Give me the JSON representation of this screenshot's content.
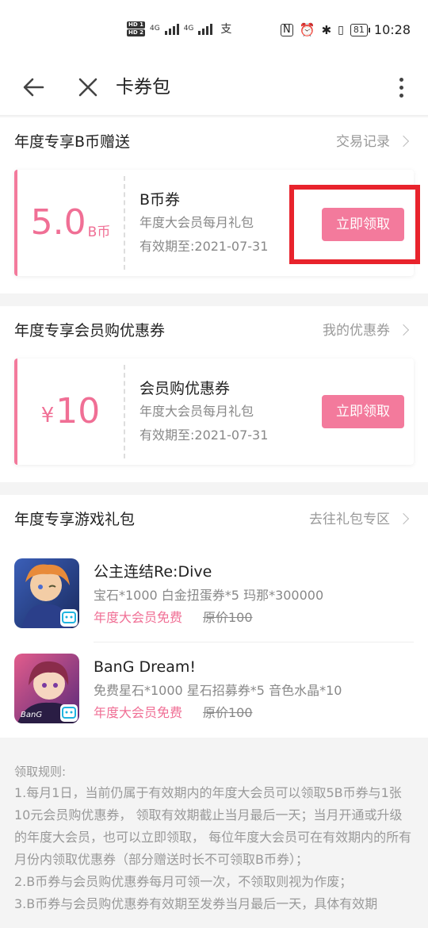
{
  "status_bar": {
    "hd1": "HD 1",
    "hd2": "HD 2",
    "net1": "4G",
    "net2": "4G",
    "pay_icon": "支",
    "battery": "81",
    "time": "10:28"
  },
  "toolbar": {
    "title": "卡券包"
  },
  "bcoin_section": {
    "title": "年度专享B币赠送",
    "link": "交易记录",
    "coupon": {
      "amount": "5.0",
      "unit": "B币",
      "name": "B币券",
      "desc": "年度大会员每月礼包",
      "expiry": "有效期至:2021-07-31",
      "button": "立即领取"
    }
  },
  "member_section": {
    "title": "年度专享会员购优惠券",
    "link": "我的优惠券",
    "coupon": {
      "currency": "¥",
      "amount": "10",
      "name": "会员购优惠券",
      "desc": "年度大会员每月礼包",
      "expiry": "有效期至:2021-07-31",
      "button": "立即领取"
    }
  },
  "game_section": {
    "title": "年度专享游戏礼包",
    "link": "去往礼包专区",
    "games": [
      {
        "name": "公主连结Re:Dive",
        "items": "宝石*1000 白金扭蛋券*5 玛那*300000",
        "free": "年度大会员免费",
        "original": "原价100"
      },
      {
        "name": "BanG Dream!",
        "items": "免费星石*1000 星石招募券*5 音色水晶*10",
        "free": "年度大会员免费",
        "original": "原价100"
      }
    ]
  },
  "rules": {
    "title": "领取规则:",
    "lines": [
      "1.每月1日，当前仍属于有效期内的年度大会员可以领取5B币券与1张10元会员购优惠券， 领取有效期截止当月最后一天；当月开通或升级的年度大会员，也可以立即领取， 每位年度大会员可在有效期内的所有月份内领取优惠券（部分赠送时长不可领取B币券）；",
      "2.B币券与会员购优惠券每月可领一次，不领取则视为作废；",
      "3.B币券与会员购优惠券有效期至发券当月最后一天，具体有效期"
    ]
  },
  "colors": {
    "accent_pink": "#f37a9c",
    "highlight_red": "#e8232c"
  }
}
